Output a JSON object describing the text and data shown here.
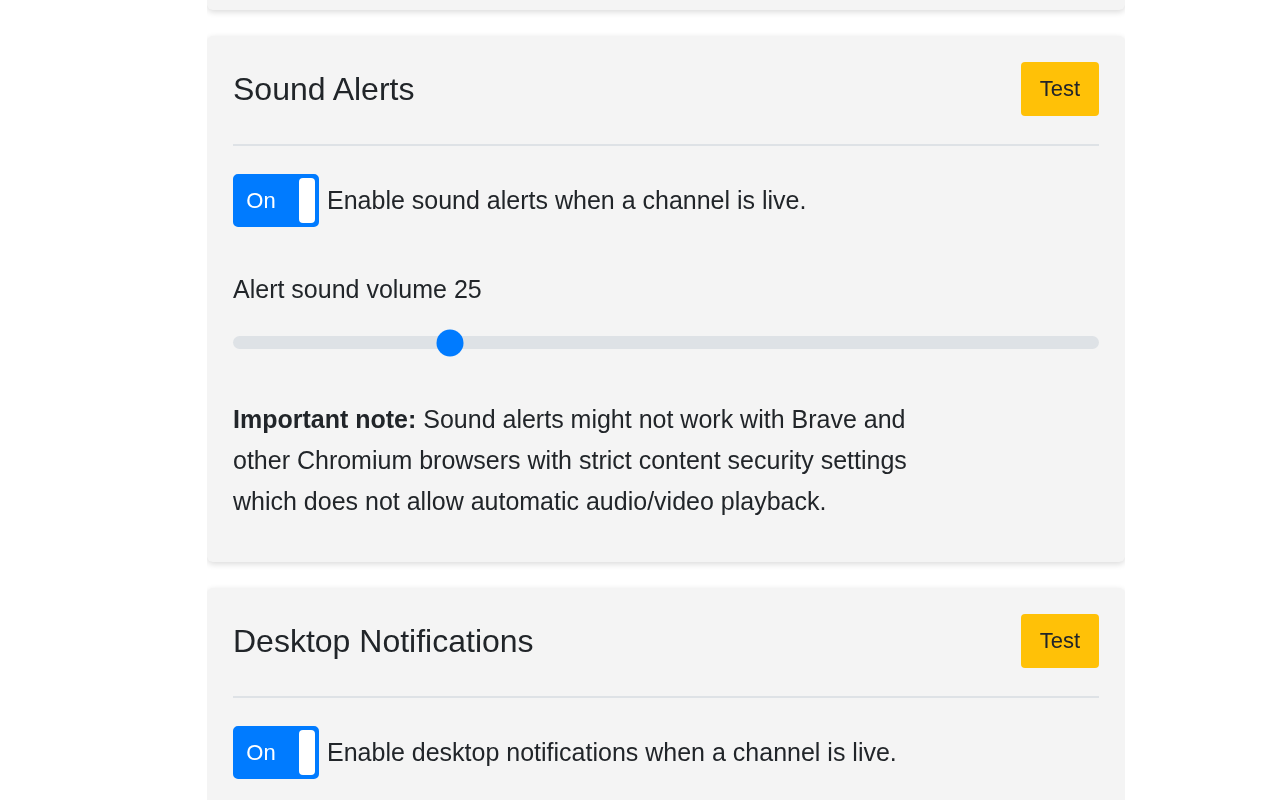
{
  "sections": [
    {
      "title": "Sound Alerts",
      "test_button": "Test",
      "toggle": {
        "label": "On",
        "on": true
      },
      "toggle_text": "Enable sound alerts when a channel is live.",
      "slider": {
        "label": "Alert sound volume 25",
        "level": 0.25
      },
      "note": "**Important note:** Sound alerts might not work with Brave and other Chromium browsers with strict content security settings which does not allow automatic audio/video playback."
    },
    {
      "title": "Desktop Notifications",
      "test_button": "Test",
      "toggle": {
        "label": "On",
        "on": true
      },
      "toggle_text": "Enable desktop notifications when a channel is live."
    }
  ]
}
